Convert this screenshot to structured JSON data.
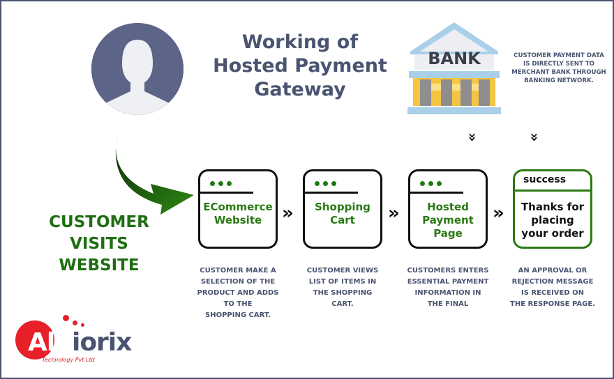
{
  "title": {
    "line1": "Working of",
    "line2": "Hosted Payment",
    "line3": "Gateway"
  },
  "icons": {
    "avatar": "user-avatar-icon",
    "bank": "bank-building-icon"
  },
  "bank": {
    "sign": "BANK",
    "note_lines": [
      "CUSTOMER PAYMENT DATA",
      "IS DIRECTLY SENT TO",
      "MERCHANT BANK THROUGH",
      "BANKING NETWORK."
    ]
  },
  "cta": {
    "lines": [
      "CUSTOMER",
      "VISITS",
      "WEBSITE"
    ]
  },
  "steps": [
    {
      "label_lines": [
        "ECommerce",
        "Website"
      ],
      "desc_lines": [
        "CUSTOMER MAKE A",
        "SELECTION OF THE",
        "PRODUCT AND ADDS",
        "TO THE",
        "SHOPPING CART."
      ]
    },
    {
      "label_lines": [
        "Shopping",
        "Cart"
      ],
      "desc_lines": [
        "CUSTOMER VIEWS",
        "LIST OF ITEMS IN",
        "THE SHOPPING",
        "CART."
      ]
    },
    {
      "label_lines": [
        "Hosted",
        "Payment",
        "Page"
      ],
      "desc_lines": [
        "CUSTOMERS ENTERS",
        "ESSENTIAL PAYMENT",
        "INFORMATION IN",
        "THE FINAL"
      ]
    },
    {
      "tag": "success",
      "label_lines": [
        "Thanks for",
        "placing",
        "your order"
      ],
      "desc_lines": [
        "AN APPROVAL OR",
        "REJECTION MESSAGE",
        "IS RECEIVED ON",
        "THE RESPONSE PAGE."
      ]
    }
  ],
  "flow_arrow": "»",
  "down_arrow": "»",
  "logo": {
    "part1": "Alb",
    "part2": "iorix",
    "subtitle": "Technology Pvt Ltd"
  },
  "colors": {
    "title": "#4a5471",
    "green": "#2a7a13",
    "avatar": "#5c6588",
    "logo_red": "#e8202a",
    "frame": "#4b5474"
  }
}
